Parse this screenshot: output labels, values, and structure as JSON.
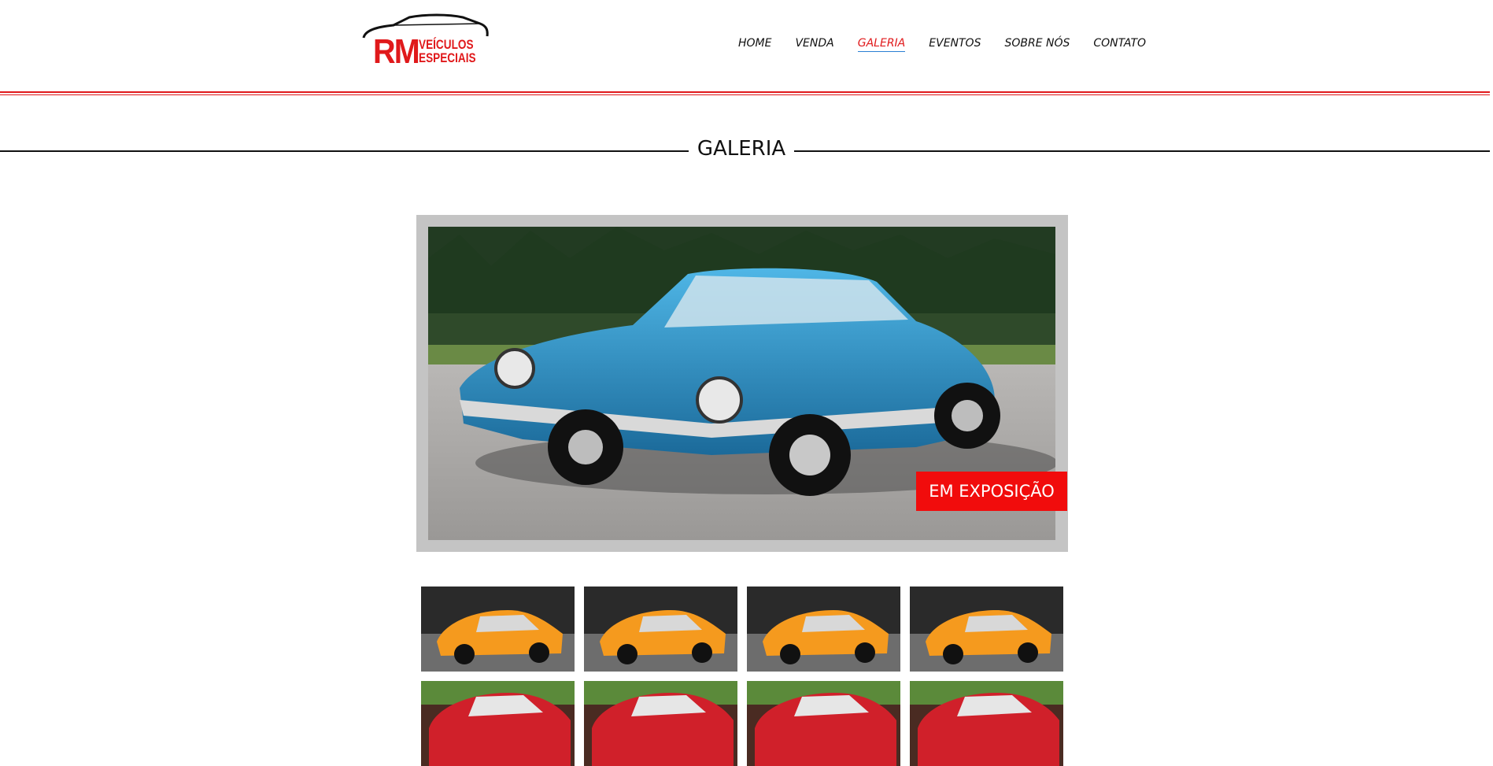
{
  "brand": {
    "logo_main": "RM",
    "logo_line1": "VEÍCULOS",
    "logo_line2": "ESPECIAIS",
    "accent_color": "#e0191b"
  },
  "nav": {
    "items": [
      {
        "label": "HOME",
        "active": false
      },
      {
        "label": "VENDA",
        "active": false
      },
      {
        "label": "GALERIA",
        "active": true
      },
      {
        "label": "EVENTOS",
        "active": false
      },
      {
        "label": "SOBRE NÓS",
        "active": false
      },
      {
        "label": "CONTATO",
        "active": false
      }
    ]
  },
  "gallery": {
    "title": "GALERIA",
    "badge": "EM EXPOSIÇÃO",
    "hero_image": "blue-muscle-car-photo",
    "thumbnails": [
      "orange-coupe-photo",
      "orange-coupe-photo",
      "orange-coupe-photo",
      "orange-coupe-photo",
      "red-coupe-photo",
      "red-coupe-photo",
      "red-coupe-photo",
      "red-coupe-photo"
    ]
  }
}
